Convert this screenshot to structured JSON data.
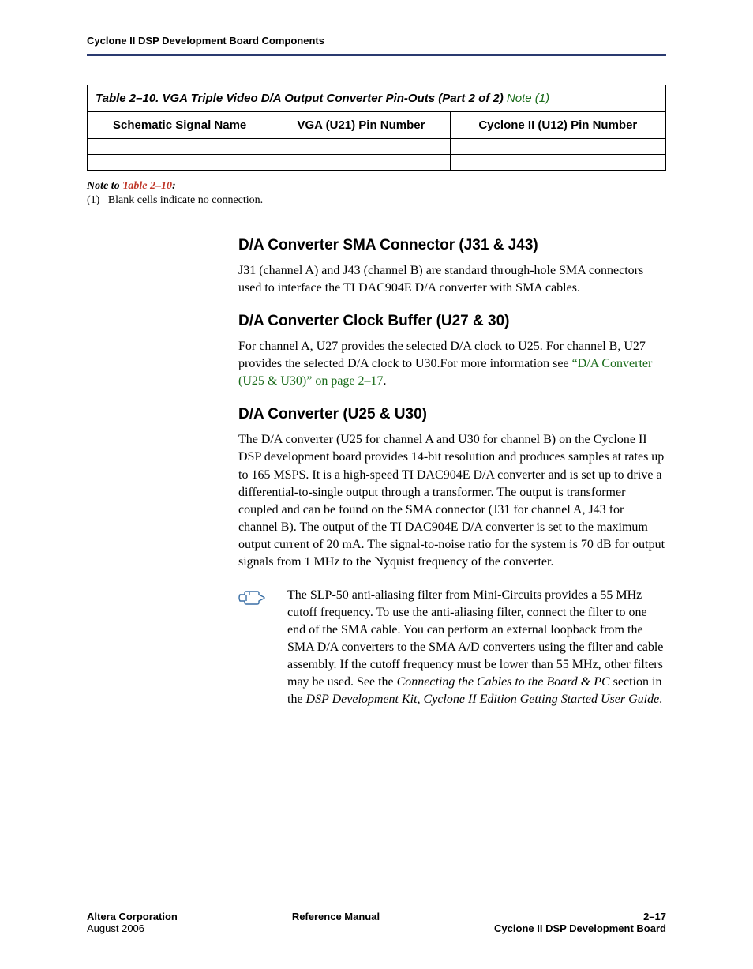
{
  "header": {
    "running_head": "Cyclone II DSP Development Board Components"
  },
  "table": {
    "title_prefix": "Table 2–10. VGA Triple Video D/A Output Converter Pin-Outs  (Part 2 of 2) ",
    "title_note": "Note (1)",
    "columns": [
      "Schematic Signal Name",
      "VGA (U21) Pin Number",
      "Cyclone II (U12) Pin Number"
    ]
  },
  "table_note": {
    "lead": "Note to ",
    "ref": "Table 2–10",
    "tail": ":",
    "item_num": "(1)",
    "item_text": "Blank cells indicate no connection."
  },
  "sections": {
    "s1": {
      "heading": "D/A Converter SMA Connector (J31 & J43)",
      "p1": "J31 (channel A) and J43 (channel B) are standard through-hole SMA connectors used to interface the TI DAC904E D/A converter with SMA cables."
    },
    "s2": {
      "heading": "D/A Converter Clock Buffer (U27 & 30)",
      "p1_pre": "For channel A, U27 provides the selected D/A clock to U25. For channel B, U27 provides the selected D/A clock to U30.For more information see ",
      "p1_link": "“D/A Converter (U25 & U30)” on page 2–17",
      "p1_post": "."
    },
    "s3": {
      "heading": "D/A Converter (U25 & U30)",
      "p1": "The D/A converter (U25 for channel A and U30 for channel B) on the Cyclone II DSP development board provides 14-bit resolution and produces samples at rates up to 165 MSPS. It is a high-speed TI DAC904E D/A converter and is set up to drive a differential-to-single output through a transformer. The output is transformer coupled and can be found on the SMA connector (J31 for channel A, J43 for channel B). The output of the TI DAC904E D/A converter is set to the maximum output current of 20 mA. The signal-to-noise ratio for the system is 70 dB for output signals from 1 MHz to the Nyquist frequency of the converter.",
      "note_pre": "The SLP-50 anti-aliasing filter from Mini-Circuits provides a 55 MHz cutoff frequency. To use the anti-aliasing filter, connect the filter to one end of the SMA cable. You can perform an external loopback from the SMA D/A converters to the SMA A/D converters using the filter and cable assembly. If the cutoff frequency must be lower than 55 MHz, other filters may be used. See the ",
      "note_ital1": "Connecting the Cables to the Board & PC",
      "note_mid": " section in the ",
      "note_ital2": "DSP Development Kit, Cyclone II Edition Getting Started User Guide",
      "note_post": "."
    }
  },
  "footer": {
    "left1": "Altera Corporation",
    "left2": "August 2006",
    "center": "Reference Manual",
    "right1": "2–17",
    "right2": "Cyclone II DSP Development Board"
  }
}
